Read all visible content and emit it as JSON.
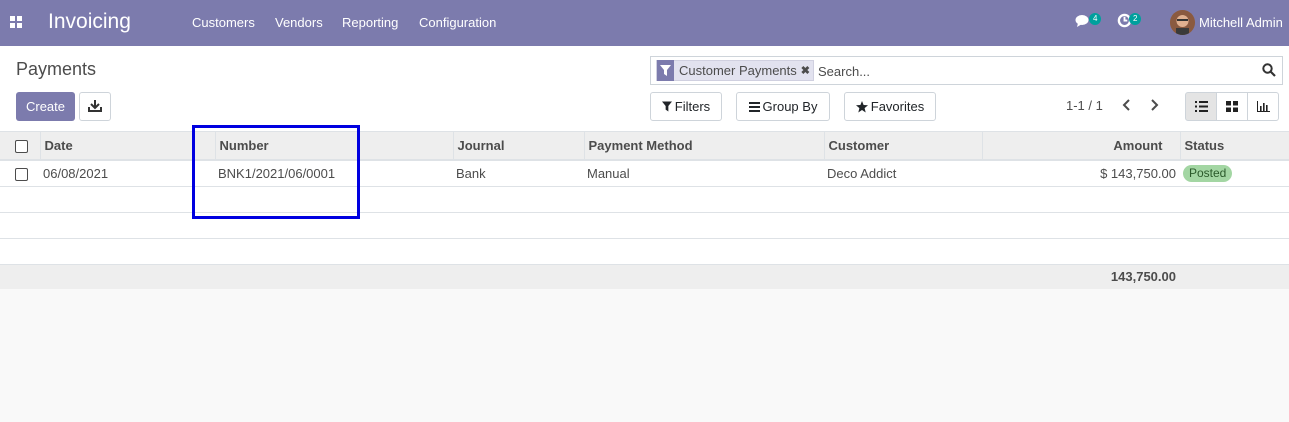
{
  "navbar": {
    "app_title": "Invoicing",
    "menu": [
      "Customers",
      "Vendors",
      "Reporting",
      "Configuration"
    ],
    "messages_count": "4",
    "activities_count": "2",
    "user_name": "Mitchell Admin"
  },
  "control_panel": {
    "breadcrumb": "Payments",
    "create_label": "Create",
    "search": {
      "facet_label": "Customer Payments",
      "placeholder": "Search..."
    },
    "filters_label": "Filters",
    "group_by_label": "Group By",
    "favorites_label": "Favorites",
    "pager": "1-1 / 1"
  },
  "table": {
    "columns": [
      "Date",
      "Number",
      "Journal",
      "Payment Method",
      "Customer",
      "Amount",
      "Status"
    ],
    "rows": [
      {
        "date": "06/08/2021",
        "number": "BNK1/2021/06/0001",
        "journal": "Bank",
        "payment_method": "Manual",
        "customer": "Deco Addict",
        "amount": "$ 143,750.00",
        "status": "Posted"
      }
    ],
    "total_amount": "143,750.00"
  },
  "colors": {
    "brand": "#7c7bad",
    "status_posted": "#a3d6a3",
    "highlight": "#0000e0"
  }
}
